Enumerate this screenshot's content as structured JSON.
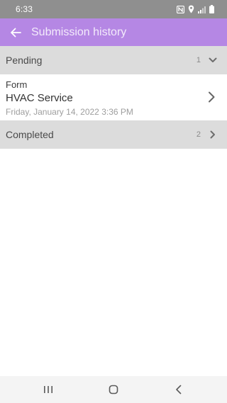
{
  "status_bar": {
    "time": "6:33",
    "icons": [
      "nfc-icon",
      "location-icon",
      "signal-icon",
      "battery-icon"
    ]
  },
  "app_bar": {
    "title": "Submission history",
    "back_icon": "arrow-left-icon",
    "color": "#b587e4"
  },
  "sections": {
    "pending": {
      "title": "Pending",
      "count": "1",
      "expanded": true,
      "items": [
        {
          "label": "Form",
          "name": "HVAC Service",
          "date": "Friday, January 14, 2022 3:36 PM"
        }
      ]
    },
    "completed": {
      "title": "Completed",
      "count": "2",
      "expanded": false
    }
  },
  "nav_bar": {
    "icons": [
      "recent-apps-icon",
      "home-icon",
      "back-icon"
    ]
  }
}
